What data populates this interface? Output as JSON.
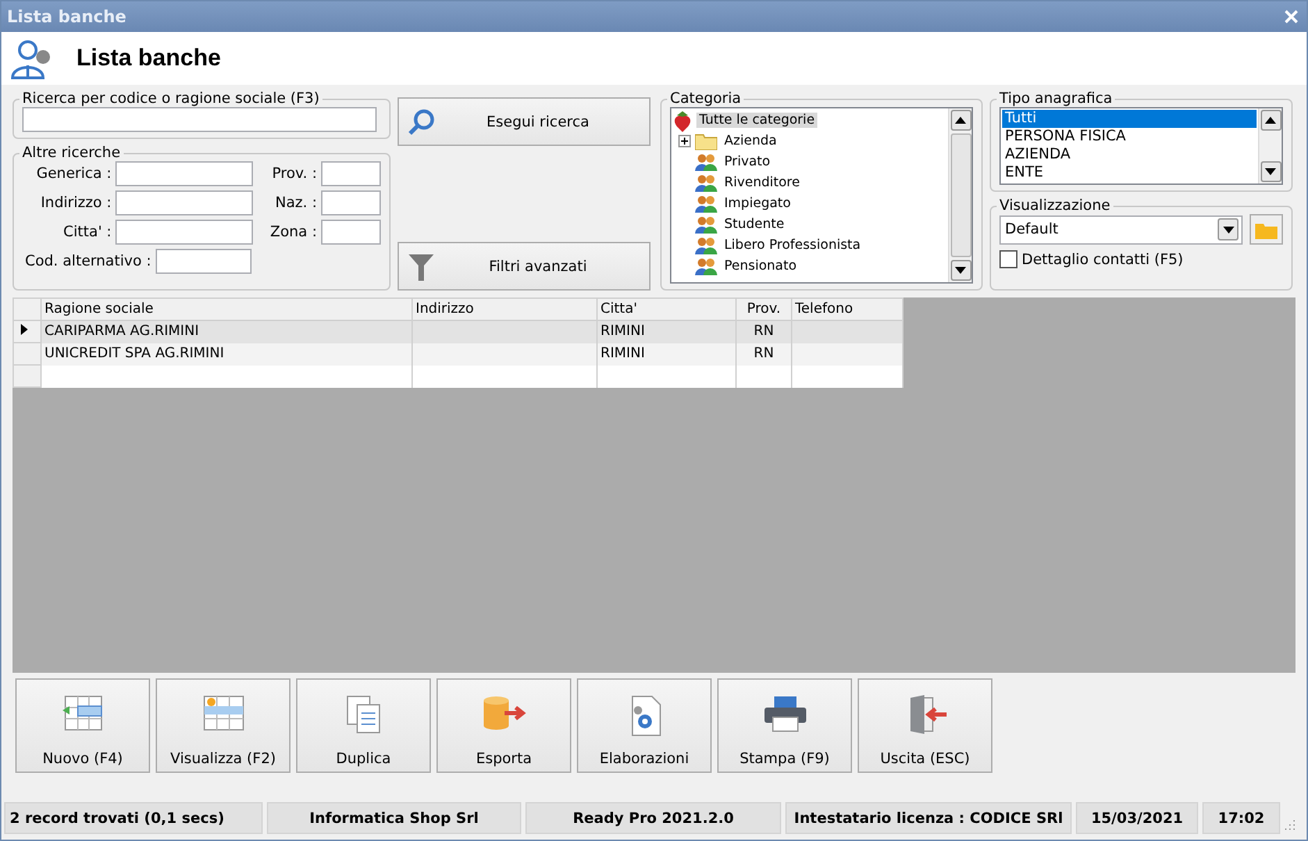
{
  "window": {
    "title": "Lista banche"
  },
  "header": {
    "title": "Lista banche"
  },
  "search": {
    "label": "Ricerca per codice o ragione sociale (F3)",
    "button": "Esegui ricerca"
  },
  "other_searches": {
    "label": "Altre ricerche",
    "fields": [
      {
        "label": "Generica :"
      },
      {
        "label": "Prov. :"
      },
      {
        "label": "Indirizzo :"
      },
      {
        "label": "Naz. :"
      },
      {
        "label": "Citta' :"
      },
      {
        "label": "Zona :"
      },
      {
        "label": "Cod. alternativo :"
      }
    ]
  },
  "filter_button": "Filtri avanzati",
  "category": {
    "label": "Categoria",
    "root": {
      "label": "Tutte le categorie",
      "selected": true,
      "children": [
        {
          "label": "Azienda",
          "kind": "folder",
          "expanded": false,
          "selected": false
        },
        {
          "label": "Privato",
          "kind": "group",
          "selected": false
        },
        {
          "label": "Rivenditore",
          "kind": "group",
          "selected": false
        },
        {
          "label": "Impiegato",
          "kind": "group",
          "selected": false
        },
        {
          "label": "Studente",
          "kind": "group",
          "selected": false
        },
        {
          "label": "Libero Professionista",
          "kind": "group",
          "selected": false
        },
        {
          "label": "Pensionato",
          "kind": "group",
          "selected": false
        }
      ]
    }
  },
  "registry_type": {
    "label": "Tipo anagrafica",
    "items": [
      {
        "label": "Tutti",
        "selected": true
      },
      {
        "label": "PERSONA FISICA",
        "selected": false
      },
      {
        "label": "AZIENDA",
        "selected": false
      },
      {
        "label": "ENTE",
        "selected": false
      }
    ]
  },
  "view": {
    "label": "Visualizzazione",
    "value": "Default",
    "contact_detail": {
      "label": "Dettaglio contatti (F5)",
      "checked": false
    }
  },
  "table": {
    "columns": [
      "Ragione sociale",
      "Indirizzo",
      "Citta'",
      "Prov.",
      "Telefono"
    ],
    "rows": [
      {
        "cells": [
          "CARIPARMA AG.RIMINI",
          "",
          "RIMINI",
          "RN",
          ""
        ],
        "selected": true
      },
      {
        "cells": [
          "UNICREDIT SPA AG.RIMINI",
          "",
          "RIMINI",
          "RN",
          ""
        ],
        "selected": false
      }
    ]
  },
  "buttons": [
    {
      "label": "Nuovo (F4)",
      "kind": "new"
    },
    {
      "label": "Visualizza (F2)",
      "kind": "view"
    },
    {
      "label": "Duplica",
      "kind": "duplicate"
    },
    {
      "label": "Esporta",
      "kind": "export"
    },
    {
      "label": "Elaborazioni",
      "kind": "process"
    },
    {
      "label": "Stampa (F9)",
      "kind": "print"
    },
    {
      "label": "Uscita (ESC)",
      "kind": "exit"
    }
  ],
  "status_bar": [
    "2 record trovati (0,1 secs)",
    "Informatica Shop Srl",
    "Ready Pro 2021.2.0",
    "Intestatario licenza : CODICE SRl",
    "15/03/2021",
    "17:02"
  ]
}
